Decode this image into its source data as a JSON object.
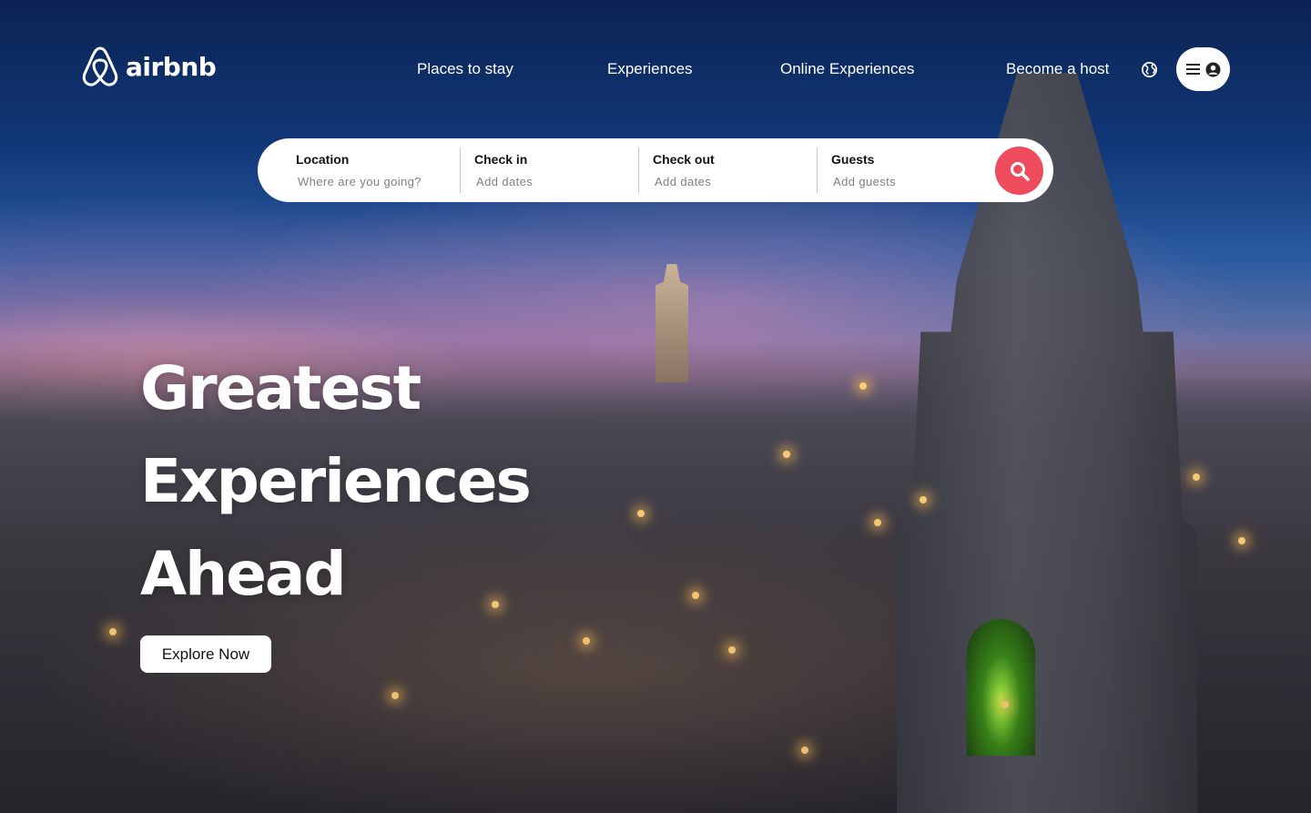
{
  "brand": {
    "name": "airbnb",
    "color": "#ee4c5c"
  },
  "nav": {
    "items": [
      {
        "label": "Places to stay"
      },
      {
        "label": "Experiences"
      },
      {
        "label": "Online Experiences"
      },
      {
        "label": "Become a host"
      }
    ],
    "globe_icon": "globe-icon",
    "menu_icon": "hamburger-menu-icon",
    "user_icon": "user-avatar-icon"
  },
  "search": {
    "location": {
      "label": "Location",
      "placeholder": "Where are you going?"
    },
    "checkin": {
      "label": "Check in",
      "placeholder": "Add dates"
    },
    "checkout": {
      "label": "Check out",
      "placeholder": "Add dates"
    },
    "guests": {
      "label": "Guests",
      "placeholder": "Add guests"
    },
    "button_icon": "search-icon"
  },
  "hero": {
    "lines": [
      "Greatest",
      "Experiences",
      "Ahead"
    ],
    "cta": "Explore Now"
  }
}
